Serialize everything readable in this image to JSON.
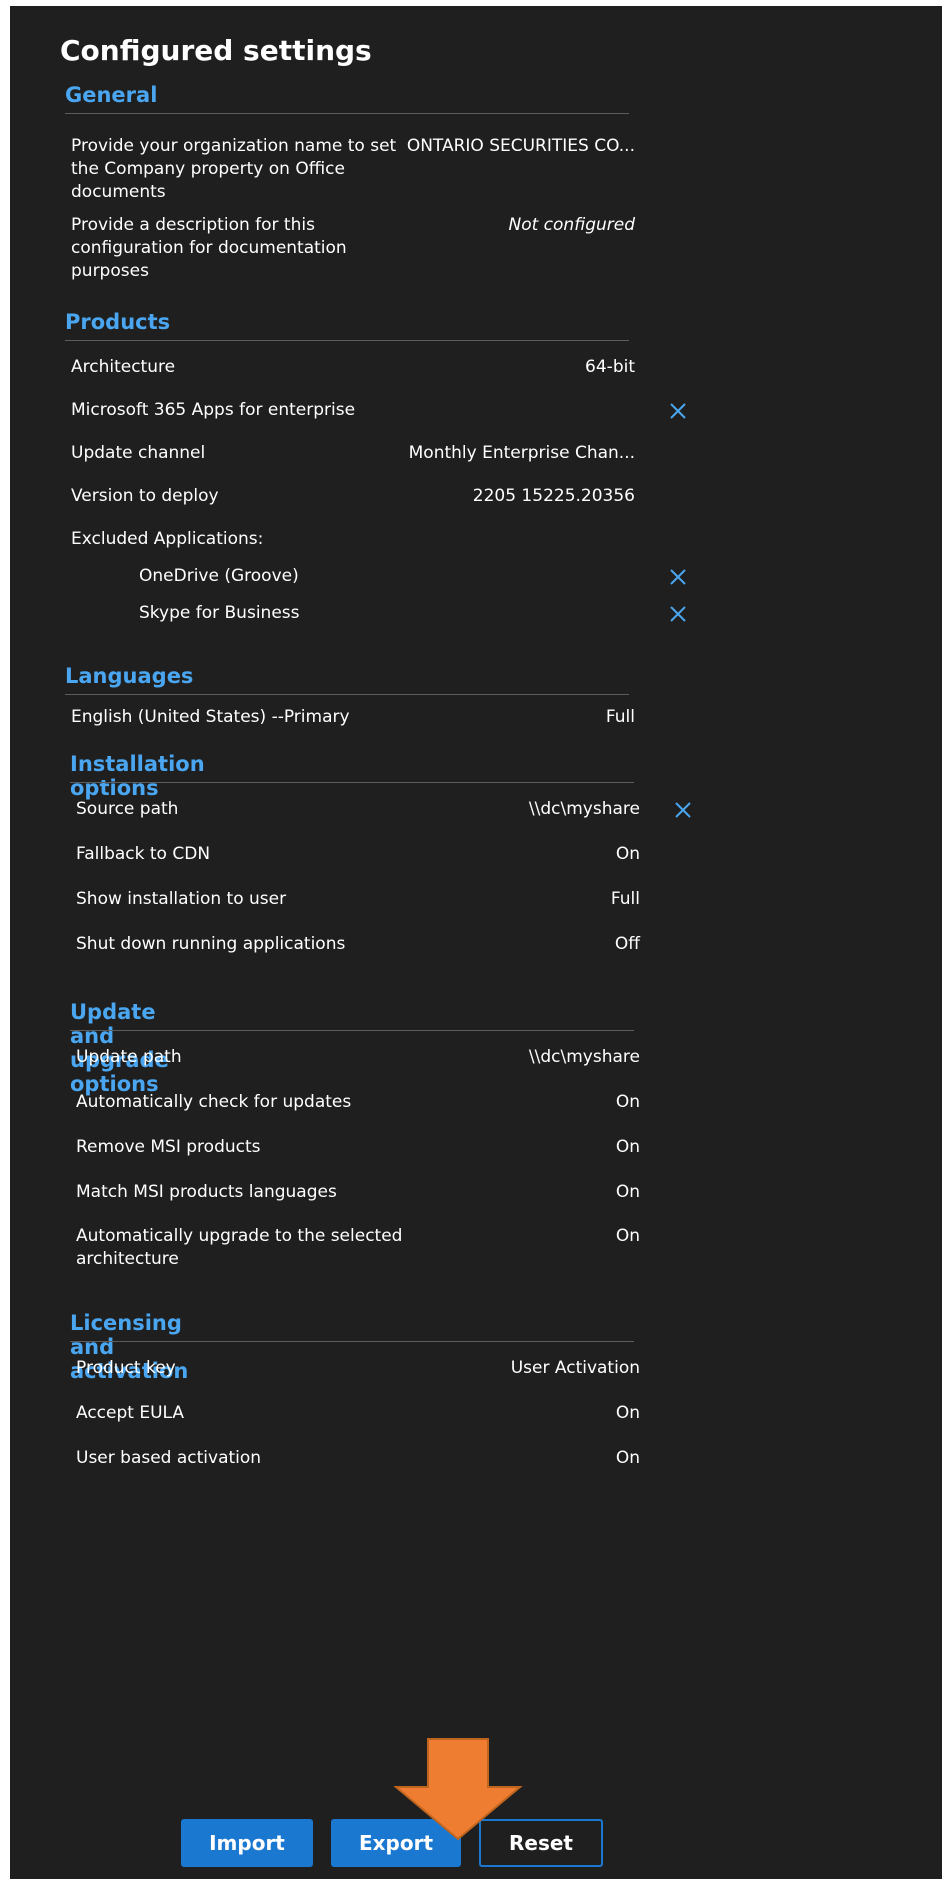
{
  "panel": {
    "title": "Configured settings"
  },
  "sections": {
    "general": {
      "title": "General",
      "rows": [
        {
          "label": "Provide your organization name to set the Company property on Office documents",
          "value": "ONTARIO SECURITIES CO..."
        },
        {
          "label": "Provide a description for this configuration for documentation purposes",
          "value": "Not configured"
        }
      ]
    },
    "products": {
      "title": "Products",
      "rows": [
        {
          "label": "Architecture",
          "value": "64-bit"
        },
        {
          "label": "Microsoft 365 Apps for enterprise",
          "value": ""
        },
        {
          "label": "Update channel",
          "value": "Monthly Enterprise Chan..."
        },
        {
          "label": "Version to deploy",
          "value": "2205 15225.20356"
        },
        {
          "label": "Excluded Applications:",
          "value": ""
        },
        {
          "label": "OneDrive (Groove)",
          "value": ""
        },
        {
          "label": "Skype for Business",
          "value": ""
        }
      ]
    },
    "languages": {
      "title": "Languages",
      "rows": [
        {
          "label": "English (United States) --Primary",
          "value": "Full"
        }
      ]
    },
    "installation": {
      "title": "Installation options",
      "rows": [
        {
          "label": "Source path",
          "value": "\\\\dc\\myshare"
        },
        {
          "label": "Fallback to CDN",
          "value": "On"
        },
        {
          "label": "Show installation to user",
          "value": "Full"
        },
        {
          "label": "Shut down running applications",
          "value": "Off"
        }
      ]
    },
    "update": {
      "title": "Update and upgrade options",
      "rows": [
        {
          "label": "Update path",
          "value": "\\\\dc\\myshare"
        },
        {
          "label": "Automatically check for updates",
          "value": "On"
        },
        {
          "label": "Remove MSI products",
          "value": "On"
        },
        {
          "label": "Match MSI products languages",
          "value": "On"
        },
        {
          "label": "Automatically upgrade to the selected architecture",
          "value": "On"
        }
      ]
    },
    "licensing": {
      "title": "Licensing and activation",
      "rows": [
        {
          "label": "Product key",
          "value": "User Activation"
        },
        {
          "label": "Accept EULA",
          "value": "On"
        },
        {
          "label": "User based activation",
          "value": "On"
        }
      ]
    }
  },
  "buttons": {
    "import": "Import",
    "export": "Export",
    "reset": "Reset"
  },
  "icons": {
    "remove": "close-icon",
    "callout": "arrow-down-icon"
  },
  "colors": {
    "panel_bg": "#1f1f1f",
    "accent": "#4aa6f0",
    "button_primary": "#1b78d0",
    "callout_arrow": "#ee7d31"
  }
}
